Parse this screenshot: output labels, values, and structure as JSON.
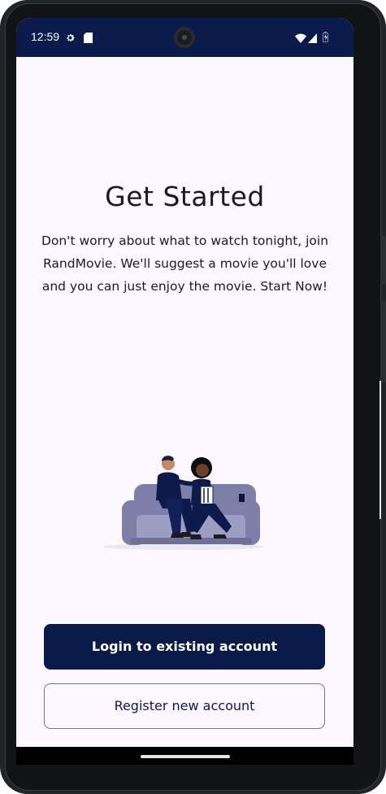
{
  "status_bar": {
    "time": "12:59",
    "icons": [
      "gear-icon",
      "sd-card-icon",
      "wifi-icon",
      "signal-icon",
      "battery-icon"
    ]
  },
  "main": {
    "title": "Get Started",
    "description": "Don't worry about what to watch tonight, join RandMovie. We'll suggest a movie you'll love and you can just enjoy the movie. Start Now!",
    "illustration": "couple-on-sofa-with-popcorn"
  },
  "actions": {
    "login_label": "Login to existing account",
    "register_label": "Register new account"
  },
  "colors": {
    "primary": "#0a1a4a",
    "background": "#fdf7ff",
    "text": "#1b1b1f"
  }
}
